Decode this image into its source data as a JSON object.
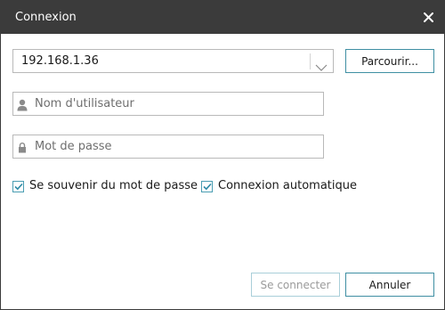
{
  "window": {
    "title": "Connexion"
  },
  "server": {
    "value": "192.168.1.36",
    "browse_label": "Parcourir..."
  },
  "username": {
    "placeholder": "Nom d'utilisateur"
  },
  "password": {
    "placeholder": "Mot de passe"
  },
  "options": {
    "remember_label": "Se souvenir du mot de passe",
    "remember_checked": true,
    "auto_label": "Connexion automatique",
    "auto_checked": true
  },
  "actions": {
    "connect_label": "Se connecter",
    "cancel_label": "Annuler"
  },
  "colors": {
    "titlebar": "#3b3b3b",
    "accent": "#3f8fa3",
    "checkmark": "#2d8aa6"
  },
  "icons": {
    "close": "close-icon",
    "dropdown": "chevron-down-icon",
    "user": "user-icon",
    "lock": "lock-icon"
  }
}
